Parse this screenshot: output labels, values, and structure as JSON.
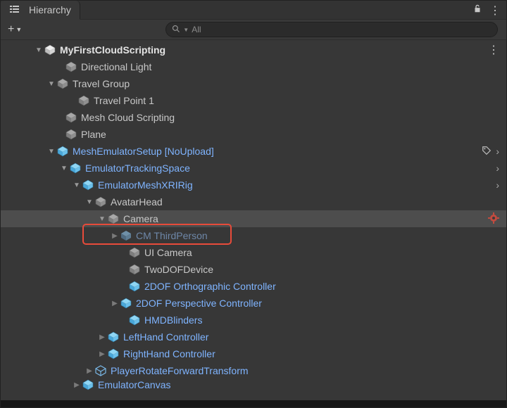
{
  "tab": {
    "title": "Hierarchy"
  },
  "toolbar": {
    "add_label": "+",
    "search_placeholder": "All"
  },
  "scene": {
    "name": "MyFirstCloudScripting"
  },
  "tree": {
    "n0": "Directional Light",
    "n1": "Travel Group",
    "n2": "Travel Point 1",
    "n3": "Mesh Cloud Scripting",
    "n4": "Plane",
    "n5": "MeshEmulatorSetup [NoUpload]",
    "n6": "EmulatorTrackingSpace",
    "n7": "EmulatorMeshXRIRig",
    "n8": "AvatarHead",
    "n9": "Camera",
    "n10": "CM ThirdPerson",
    "n11": "UI Camera",
    "n12": "TwoDOFDevice",
    "n13": "2DOF Orthographic Controller",
    "n14": "2DOF Perspective Controller",
    "n15": "HMDBlinders",
    "n16": "LeftHand Controller",
    "n17": "RightHand Controller",
    "n18": "PlayerRotateForwardTransform",
    "n19": "EmulatorCanvas"
  }
}
